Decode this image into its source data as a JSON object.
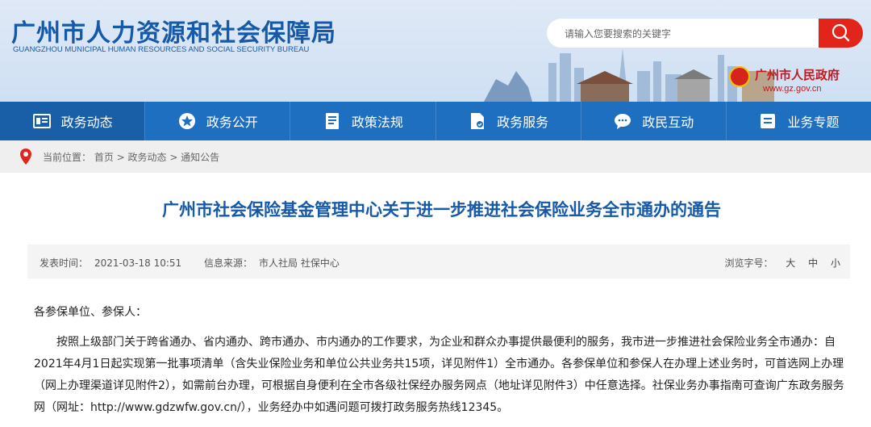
{
  "header": {
    "title_cn": "广州市人力资源和社会保障局",
    "title_en": "GUANGZHOU MUNICIPAL HUMAN RESOURCES AND SOCIAL SECURITY BUREAU",
    "search_placeholder": "请输入您要搜索的关键字",
    "gov_name": "广州市人民政府",
    "gov_url": "www.gz.gov.cn",
    "search_icon": "magnifier-icon",
    "accent_color": "#1e6fbf",
    "search_button_color": "#e1251b"
  },
  "nav": {
    "items": [
      {
        "label": "政务动态",
        "icon": "news-icon"
      },
      {
        "label": "政务公开",
        "icon": "star-icon"
      },
      {
        "label": "政策法规",
        "icon": "document-icon"
      },
      {
        "label": "政务服务",
        "icon": "service-icon"
      },
      {
        "label": "政民互动",
        "icon": "chat-icon"
      },
      {
        "label": "业务专题",
        "icon": "list-icon"
      }
    ]
  },
  "breadcrumb": {
    "text": "当前位置： 首页 > 政务动态 > 通知公告",
    "icon": "location-pin-icon"
  },
  "article": {
    "title": "广州市社会保险基金管理中心关于进一步推进社会保险业务全市通办的通告",
    "published_label": "发表时间：",
    "published_value": "2021-03-18 10:51",
    "source_label": "信息来源：",
    "source_value": "市人社局 社保中心",
    "font_label": "浏览字号：",
    "font_sizes": [
      "大",
      "中",
      "小"
    ],
    "greeting": "各参保单位、参保人：",
    "paragraph": "按照上级部门关于跨省通办、省内通办、跨市通办、市内通办的工作要求，为企业和群众办事提供最便利的服务，我市进一步推进社会保险业务全市通办：自2021年4月1日起实现第一批事项清单（含失业保险业务和单位公共业务共15项，详见附件1）全市通办。各参保单位和参保人在办理上述业务时，可首选网上办理（网上办理渠道详见附件2），如需前台办理，可根据自身便利在全市各级社保经办服务网点（地址详见附件3）中任意选择。社保业务办事指南可查询广东政务服务网（网址：http://www.gdzwfw.gov.cn/），业务经办中如遇问题可拨打政务服务热线12345。"
  }
}
